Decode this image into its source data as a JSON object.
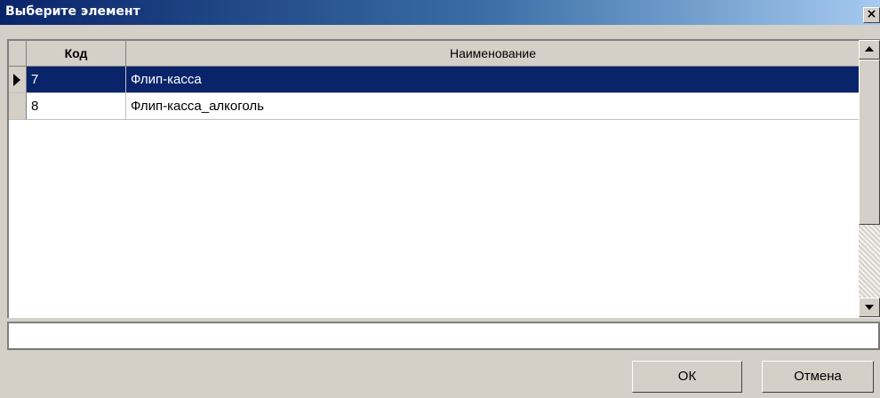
{
  "window": {
    "title": "Выберите элемент",
    "close_label": "×"
  },
  "grid": {
    "columns": [
      {
        "key": "code",
        "label": "Код"
      },
      {
        "key": "name",
        "label": "Наименование"
      }
    ],
    "rows": [
      {
        "code": "7",
        "name": "Флип-касса",
        "selected": true
      },
      {
        "code": "8",
        "name": "Флип-касса_алкоголь",
        "selected": false
      }
    ]
  },
  "filter": {
    "value": ""
  },
  "buttons": {
    "ok_label": "ОК",
    "cancel_label": "Отмена"
  },
  "icons": {
    "close": "close-icon",
    "row_pointer": "row-pointer-icon",
    "scroll_up": "scroll-up-icon",
    "scroll_down": "scroll-down-icon"
  },
  "colors": {
    "selection": "#0a246a",
    "titlebar": "#0a246a"
  }
}
